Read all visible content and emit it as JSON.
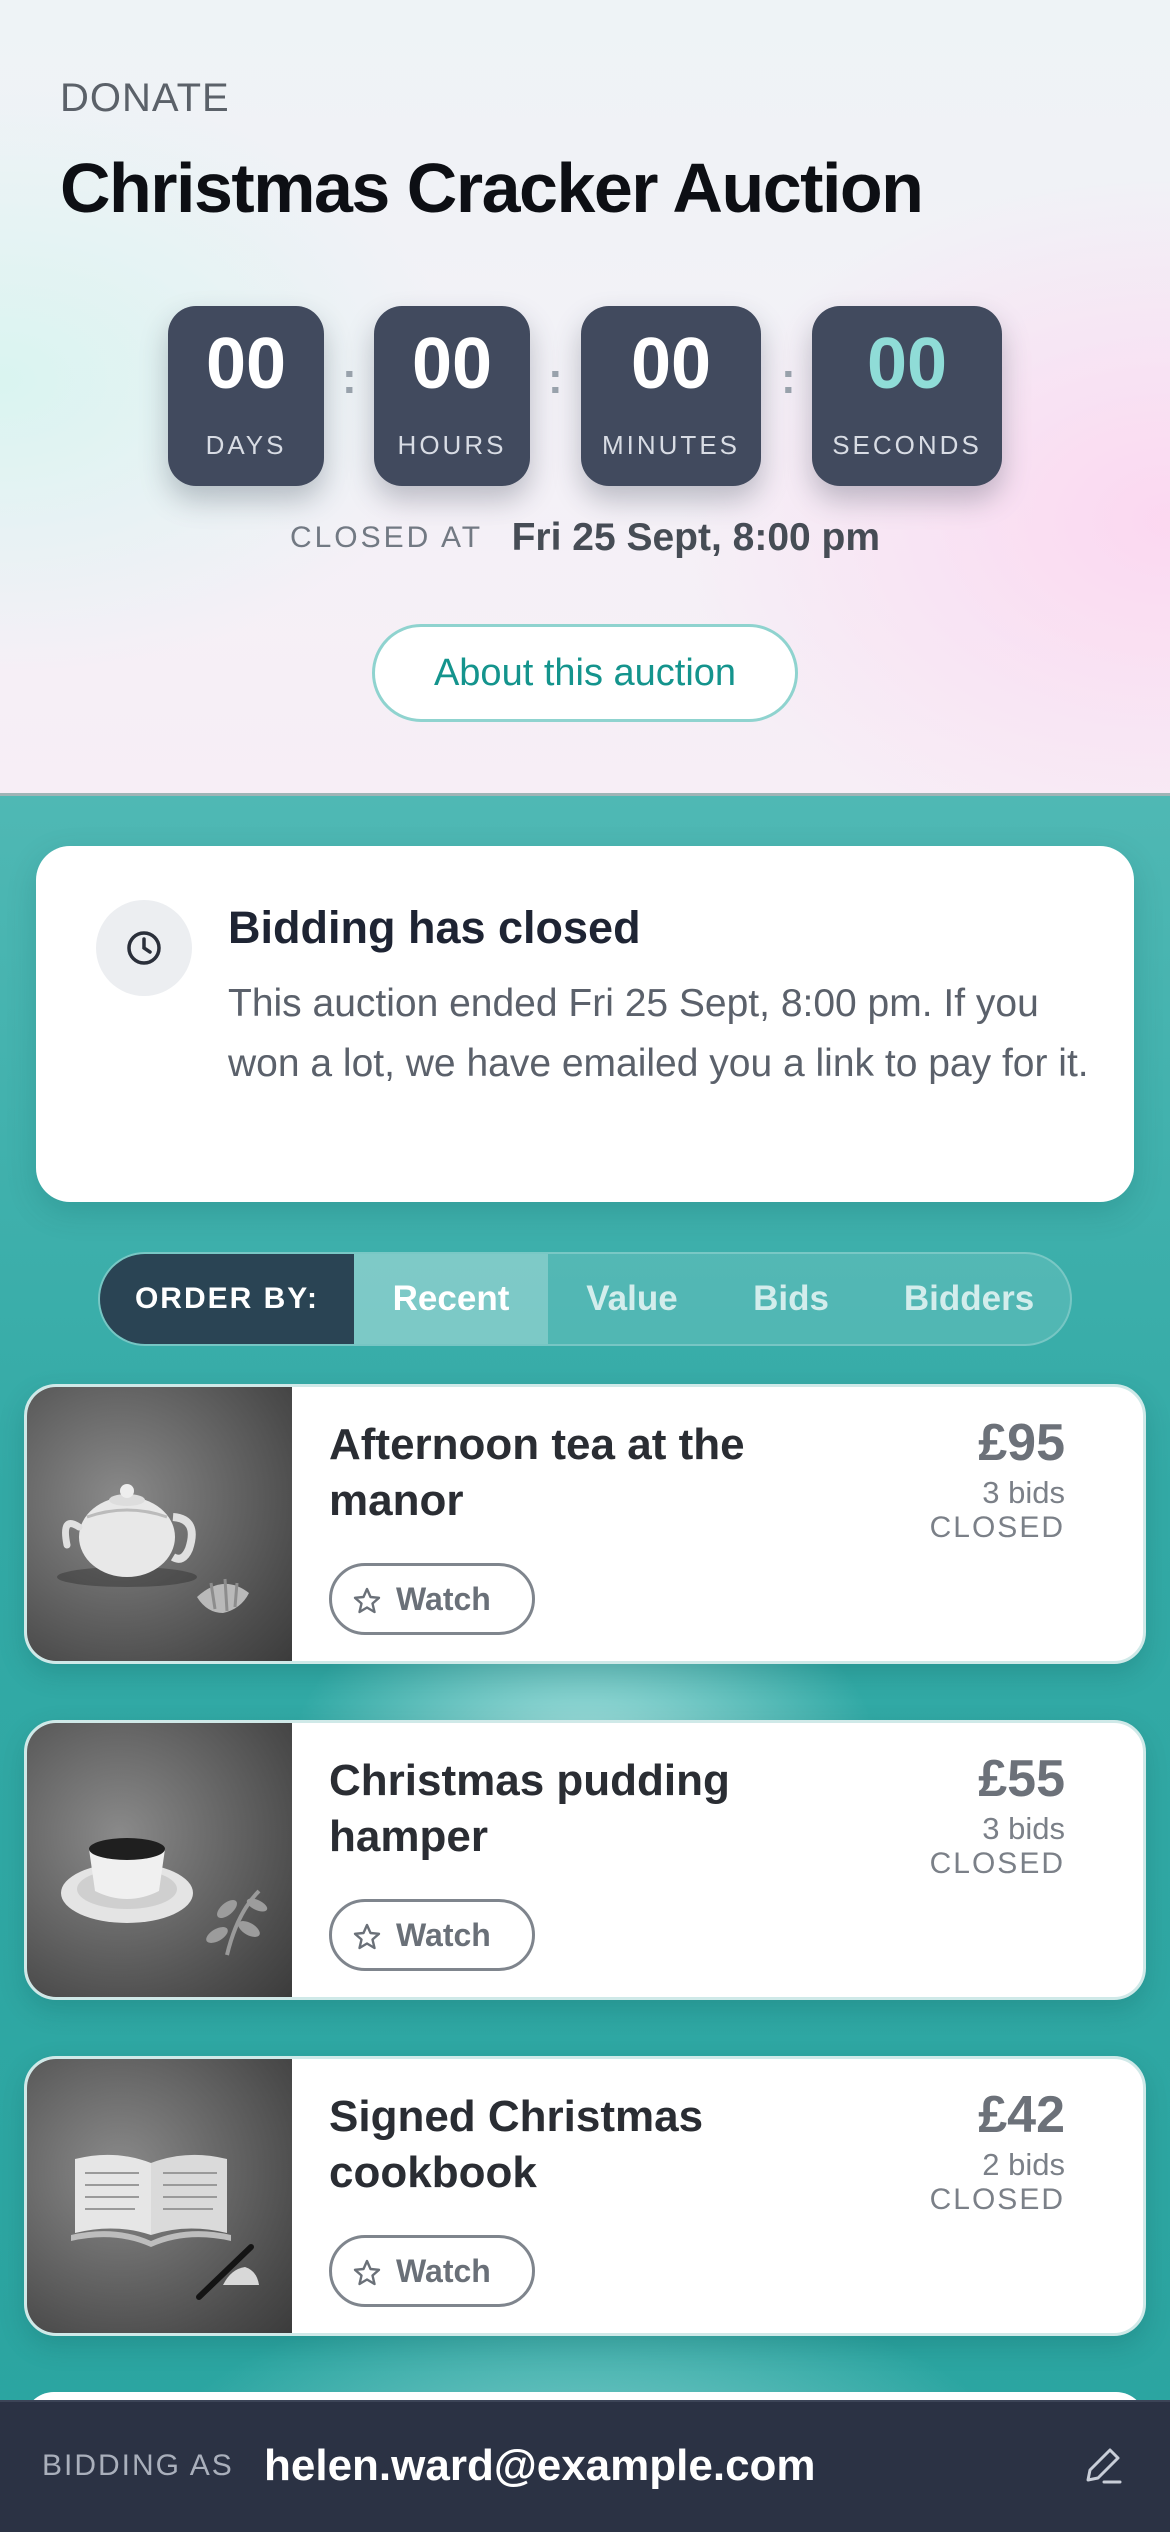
{
  "header": {
    "eyebrow": "DONATE",
    "title": "Christmas Cracker Auction",
    "countdown": {
      "days": {
        "value": "00",
        "label": "DAYS"
      },
      "hours": {
        "value": "00",
        "label": "HOURS"
      },
      "minutes": {
        "value": "00",
        "label": "MINUTES"
      },
      "seconds": {
        "value": "00",
        "label": "SECONDS"
      },
      "separator": ":"
    },
    "closed_at_label": "CLOSED AT",
    "closed_at_value": "Fri 25 Sept, 8:00 pm",
    "about_button": "About this auction"
  },
  "notice": {
    "icon": "clock-icon",
    "title": "Bidding has closed",
    "text": "This auction ended Fri 25 Sept, 8:00 pm. If you won a lot, we have emailed you a link to pay for it."
  },
  "order": {
    "label": "ORDER BY:",
    "options": [
      "Recent",
      "Value",
      "Bids",
      "Bidders"
    ],
    "selected": "Recent"
  },
  "lots": [
    {
      "name": "Afternoon tea at the manor",
      "price": "£95",
      "bids": "3 bids",
      "status": "CLOSED",
      "watch": "Watch",
      "image": "teapot-croissant-image"
    },
    {
      "name": "Christmas pudding hamper",
      "price": "£55",
      "bids": "3 bids",
      "status": "CLOSED",
      "watch": "Watch",
      "image": "coffee-cup-leaf-image"
    },
    {
      "name": "Signed Christmas cookbook",
      "price": "£42",
      "bids": "2 bids",
      "status": "CLOSED",
      "watch": "Watch",
      "image": "open-book-pen-image"
    }
  ],
  "footer": {
    "label": "BIDDING AS",
    "email": "helen.ward@example.com",
    "edit_icon": "pencil-icon"
  },
  "colors": {
    "accent_teal": "#2fa9a5",
    "dark_navy": "#2b3244",
    "countdown_box": "#414a5e",
    "seconds_accent": "#8fdcd7"
  }
}
